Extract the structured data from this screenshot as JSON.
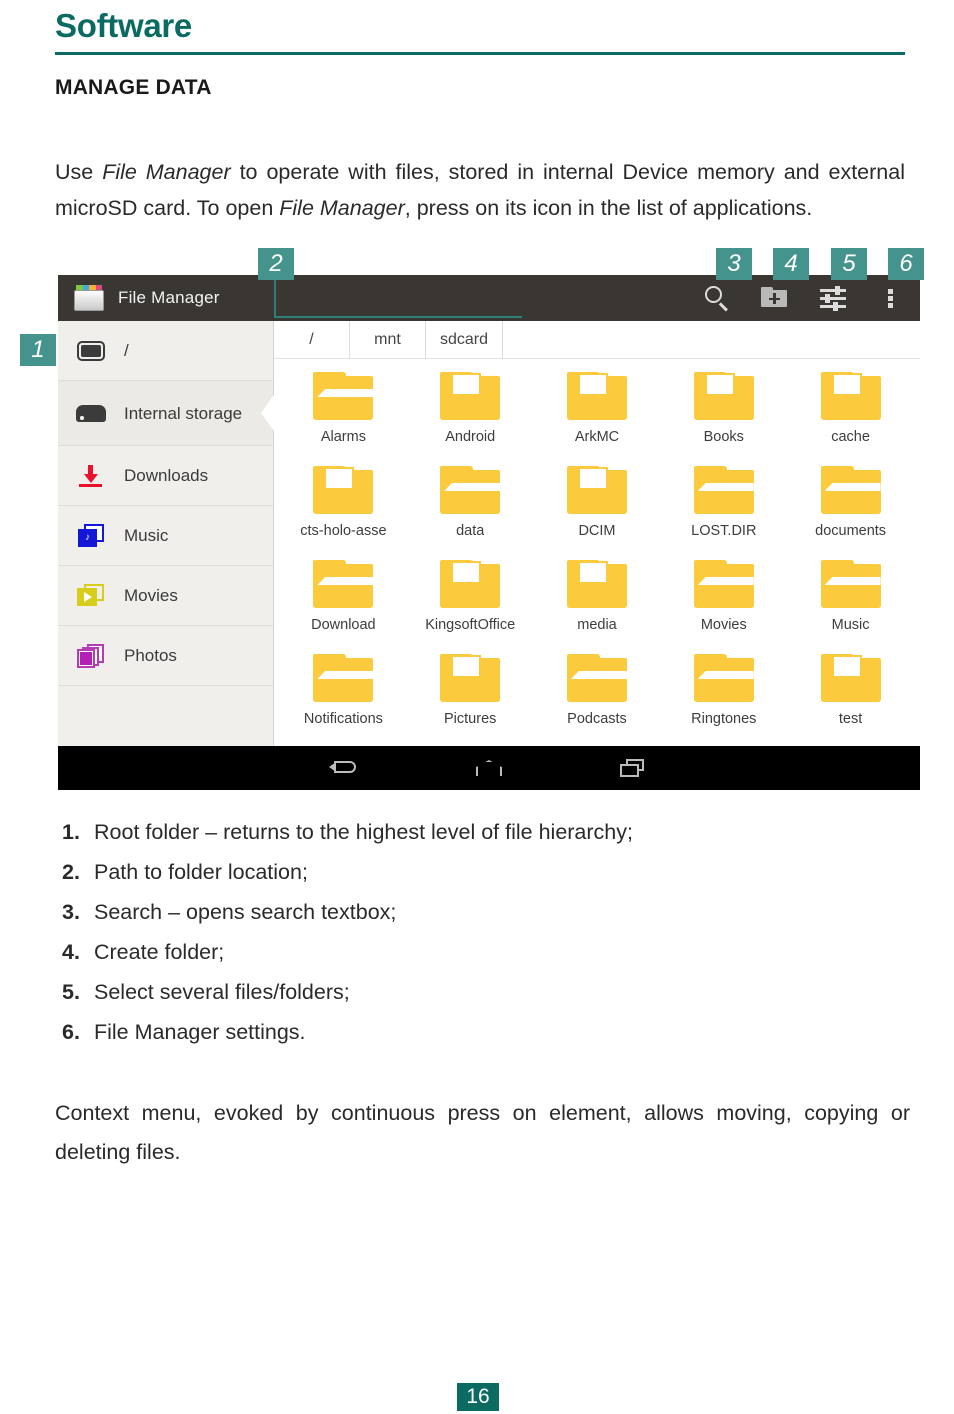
{
  "page": {
    "title": "Software",
    "section_heading": "MANAGE DATA",
    "number": "16",
    "accent_color": "#0b6b62",
    "callout_color": "#44938c"
  },
  "intro": {
    "part1": "Use ",
    "em1": "File Manager",
    "part2": " to operate with files, stored in internal Device memory and external microSD card. To open ",
    "em2": "File Manager",
    "part3": ", press on its icon in the list of applications."
  },
  "screenshot": {
    "actionbar": {
      "app_title": "File Manager",
      "app_icon": "file-manager-app-icon",
      "actions": [
        {
          "name": "search-icon",
          "label": "Search"
        },
        {
          "name": "new-folder-icon",
          "label": "Create folder"
        },
        {
          "name": "sliders-settings-icon",
          "label": "Select several files/folders"
        },
        {
          "name": "overflow-menu-icon",
          "label": "File Manager settings"
        }
      ]
    },
    "sidebar": {
      "items": [
        {
          "label": "/",
          "icon": "root-folder-icon",
          "selected": false,
          "two_line": false
        },
        {
          "label": "Internal storage",
          "icon": "hard-drive-icon",
          "selected": true,
          "two_line": true
        },
        {
          "label": "Downloads",
          "icon": "download-arrow-icon",
          "selected": false,
          "two_line": false
        },
        {
          "label": "Music",
          "icon": "music-note-icon",
          "selected": false,
          "two_line": false
        },
        {
          "label": "Movies",
          "icon": "movie-play-icon",
          "selected": false,
          "two_line": false
        },
        {
          "label": "Photos",
          "icon": "photos-stack-icon",
          "selected": false,
          "two_line": false
        }
      ]
    },
    "breadcrumbs": [
      "/",
      "mnt",
      "sdcard"
    ],
    "folders": [
      {
        "name": "Alarms",
        "style": "plain"
      },
      {
        "name": "Android",
        "style": "doc"
      },
      {
        "name": "ArkMC",
        "style": "doc"
      },
      {
        "name": "Books",
        "style": "doc"
      },
      {
        "name": "cache",
        "style": "doc"
      },
      {
        "name": "cts-holo-asse",
        "style": "doc"
      },
      {
        "name": "data",
        "style": "plain"
      },
      {
        "name": "DCIM",
        "style": "doc"
      },
      {
        "name": "LOST.DIR",
        "style": "plain"
      },
      {
        "name": "documents",
        "style": "plain"
      },
      {
        "name": "Download",
        "style": "plain"
      },
      {
        "name": "KingsoftOffice",
        "style": "doc"
      },
      {
        "name": "media",
        "style": "doc"
      },
      {
        "name": "Movies",
        "style": "plain"
      },
      {
        "name": "Music",
        "style": "plain"
      },
      {
        "name": "Notifications",
        "style": "plain"
      },
      {
        "name": "Pictures",
        "style": "doc"
      },
      {
        "name": "Podcasts",
        "style": "plain"
      },
      {
        "name": "Ringtones",
        "style": "plain"
      },
      {
        "name": "test",
        "style": "doc"
      }
    ],
    "navbar": [
      {
        "name": "back-nav-icon"
      },
      {
        "name": "home-nav-icon"
      },
      {
        "name": "recents-nav-icon"
      }
    ],
    "callouts": [
      {
        "n": "1"
      },
      {
        "n": "2"
      },
      {
        "n": "3"
      },
      {
        "n": "4"
      },
      {
        "n": "5"
      },
      {
        "n": "6"
      }
    ]
  },
  "legend": [
    {
      "num": "1.",
      "text": "Root folder – returns to the highest level of file hierarchy;"
    },
    {
      "num": "2.",
      "text": "Path to folder location;"
    },
    {
      "num": "3.",
      "text": "Search – opens search textbox;"
    },
    {
      "num": "4.",
      "text": "Create folder;"
    },
    {
      "num": "5.",
      "text": "Select several files/folders;"
    },
    {
      "num": "6.",
      "text": "File Manager settings."
    }
  ],
  "closing": "Context menu, evoked by continuous press on element, allows moving, copying or deleting files."
}
